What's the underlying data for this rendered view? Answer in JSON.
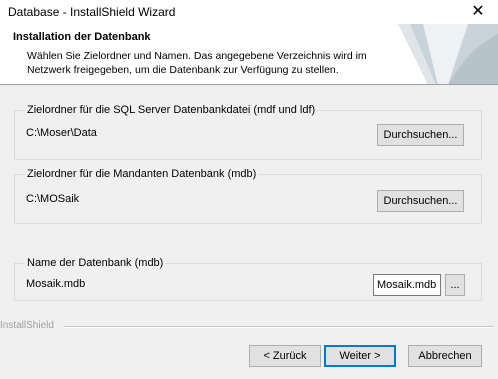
{
  "window": {
    "title": "Database - InstallShield Wizard"
  },
  "header": {
    "title": "Installation der Datenbank",
    "description": "Wählen Sie Zielordner und Namen. Das angegebene Verzeichnis wird im Netzwerk freigegeben, um die Datenbank zur Verfügung zu stellen."
  },
  "groups": {
    "sql": {
      "label": "Zielordner für die SQL Server Datenbankdatei (mdf und ldf)",
      "path": "C:\\Moser\\Data",
      "button": "Durchsuchen..."
    },
    "mandanten": {
      "label": "Zielordner für die Mandanten Datenbank (mdb)",
      "path": "C:\\MOSaik",
      "button": "Durchsuchen..."
    },
    "dbname": {
      "label": "Name der Datenbank (mdb)",
      "value": "Mosaik.mdb",
      "input_value": "Mosaik.mdb",
      "button": "..."
    }
  },
  "footer": {
    "brand": "InstallShield",
    "back": "< Zurück",
    "next": "Weiter >",
    "cancel": "Abbrechen"
  },
  "colors": {
    "default_button_border": "#0078d7",
    "background": "#f0f0f0"
  },
  "icons": {
    "close": "close-icon",
    "header_art": "page-curl-graphic"
  }
}
